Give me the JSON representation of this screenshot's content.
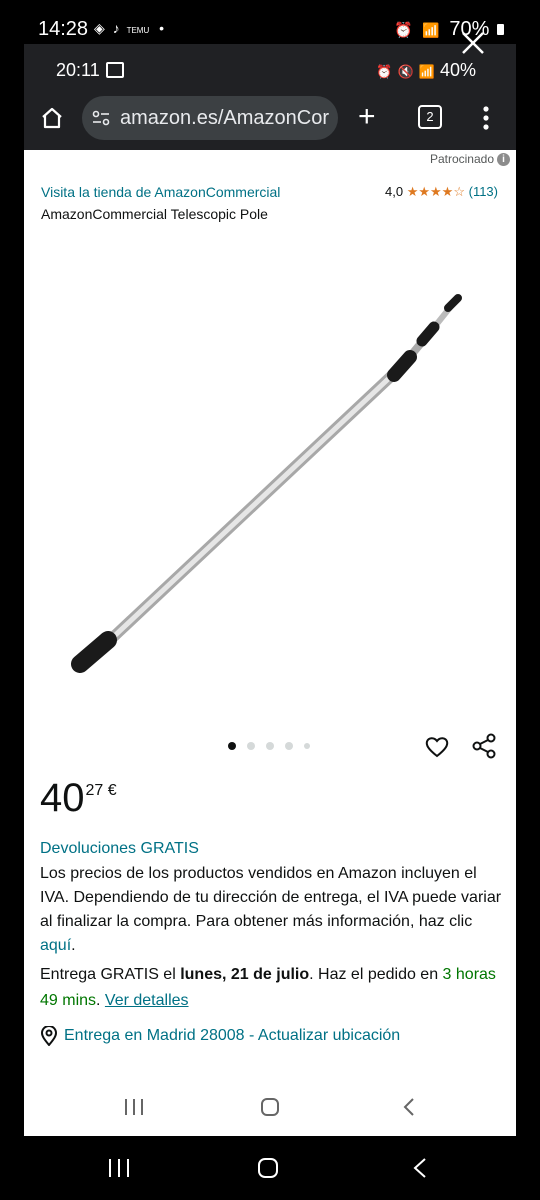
{
  "outer_status": {
    "time": "14:28",
    "extra": "TEMU",
    "battery": "70%"
  },
  "inner_status": {
    "time": "20:11",
    "battery": "40%"
  },
  "browser": {
    "url": "amazon.es/AmazonCor",
    "tab_count": "2"
  },
  "ad": {
    "sponsored_label": "Patrocinado",
    "info_glyph": "i",
    "store_link": "Visita la tienda de AmazonCommercial",
    "rating_value": "4,0",
    "rating_stars": "★★★★☆",
    "rating_count": "(113)",
    "product_name": "AmazonCommercial Telescopic Pole"
  },
  "gallery": {
    "dot_count": 5,
    "active_dot": 0
  },
  "price": {
    "whole": "40",
    "fraction": "27 €"
  },
  "returns": "Devoluciones GRATIS",
  "vat": {
    "text": "Los precios de los productos vendidos en Amazon incluyen el IVA. Dependiendo de tu dirección de entrega, el IVA puede variar al finalizar la compra. Para obtener más información, haz clic ",
    "link": "aquí",
    "end": "."
  },
  "delivery": {
    "prefix": "Entrega GRATIS el ",
    "date": "lunes, 21 de julio",
    "middle": ". Haz el pedido en ",
    "time_left": "3 horas 49 mins",
    "sep": ". ",
    "details_link": "Ver detalles"
  },
  "location": "Entrega en Madrid 28008 - Actualizar ubicación",
  "colors": {
    "link": "#007185",
    "star": "#de7921",
    "green": "#007600"
  }
}
